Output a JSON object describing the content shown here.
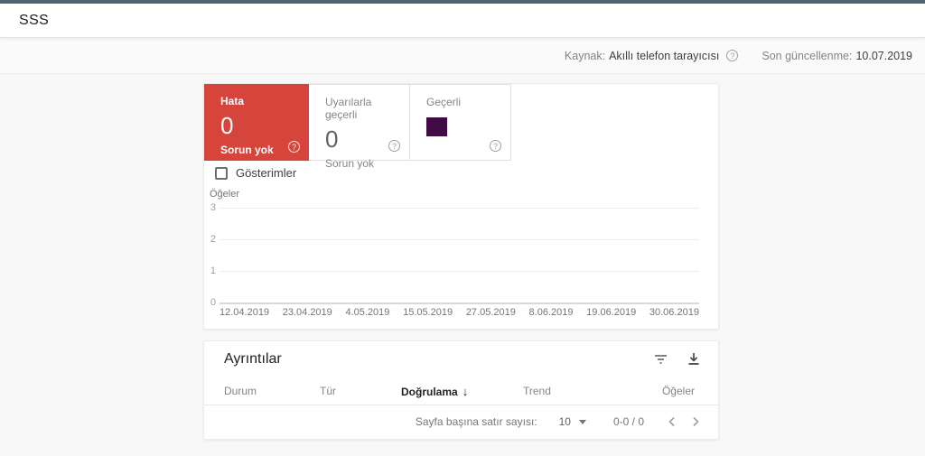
{
  "appbar": {
    "title": "SSS"
  },
  "meta": {
    "source_label": "Kaynak:",
    "source_value": "Akıllı telefon tarayıcısı",
    "updated_label": "Son güncellenme:",
    "updated_value": "10.07.2019"
  },
  "summary": {
    "tiles": [
      {
        "label": "Hata",
        "count": "0",
        "sub": "Sorun yok",
        "selected": true
      },
      {
        "label": "Uyarılarla geçerli",
        "count": "0",
        "sub": "Sorun yok",
        "selected": false
      },
      {
        "label": "Geçerli",
        "swatch_color": "#400b42",
        "selected": false
      }
    ],
    "checkbox_label": "Gösterimler",
    "checkbox_checked": false
  },
  "chart_data": {
    "type": "line",
    "title": "",
    "xlabel": "",
    "ylabel": "Öğeler",
    "ylim": [
      0,
      3
    ],
    "yticks": [
      "3",
      "2",
      "1",
      "0"
    ],
    "x": [
      "12.04.2019",
      "23.04.2019",
      "4.05.2019",
      "15.05.2019",
      "27.05.2019",
      "8.06.2019",
      "19.06.2019",
      "30.06.2019"
    ],
    "series": [],
    "grid": true,
    "legend": false,
    "note": "empty chart - no data points plotted (0 items)"
  },
  "details": {
    "title": "Ayrıntılar",
    "columns": [
      "Durum",
      "Tür",
      "Doğrulama",
      "Trend",
      "Öğeler"
    ],
    "sorted_column": "Doğrulama",
    "sort_direction": "desc",
    "rows": [],
    "pagination": {
      "rows_per_page_label": "Sayfa başına satır sayısı:",
      "rows_per_page": "10",
      "range": "0-0 / 0"
    }
  },
  "colors": {
    "topstrip": "#4e6470",
    "error_red": "#d6453c",
    "valid_swatch_purple": "#400b42",
    "card_bg": "#ffffff",
    "page_bg": "#f8f8f8"
  }
}
